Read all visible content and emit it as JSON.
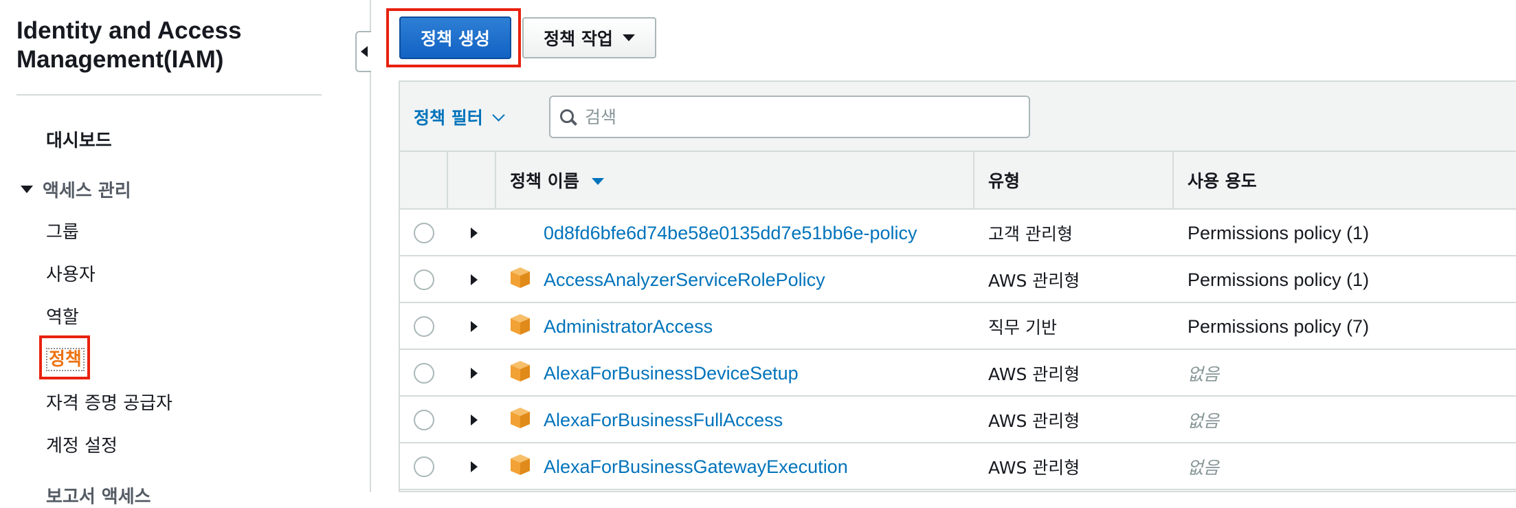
{
  "sidebar": {
    "title": "Identity and Access Management(IAM)",
    "dashboard": "대시보드",
    "section_access": "액세스 관리",
    "items": [
      "그룹",
      "사용자",
      "역할",
      "정책",
      "자격 증명 공급자",
      "계정 설정"
    ],
    "next_section": "보고서 액세스"
  },
  "toolbar": {
    "create_label": "정책 생성",
    "actions_label": "정책 작업"
  },
  "filter": {
    "label": "정책 필터",
    "search_placeholder": "검색"
  },
  "table": {
    "columns": [
      "정책 이름",
      "유형",
      "사용 용도"
    ],
    "rows": [
      {
        "name": "0d8fd6bfe6d74be58e0135dd7e51bb6e-policy",
        "type": "고객 관리형",
        "usage": "Permissions policy (1)",
        "aws_icon": false
      },
      {
        "name": "AccessAnalyzerServiceRolePolicy",
        "type": "AWS 관리형",
        "usage": "Permissions policy (1)",
        "aws_icon": true
      },
      {
        "name": "AdministratorAccess",
        "type": "직무 기반",
        "usage": "Permissions policy (7)",
        "aws_icon": true
      },
      {
        "name": "AlexaForBusinessDeviceSetup",
        "type": "AWS 관리형",
        "usage": "없음",
        "aws_icon": true
      },
      {
        "name": "AlexaForBusinessFullAccess",
        "type": "AWS 관리형",
        "usage": "없음",
        "aws_icon": true
      },
      {
        "name": "AlexaForBusinessGatewayExecution",
        "type": "AWS 관리형",
        "usage": "없음",
        "aws_icon": true
      }
    ]
  },
  "colors": {
    "link": "#0073bb",
    "primary_button": "#1a6fcf",
    "active_nav": "#ec7211",
    "highlight": "#e8210f",
    "aws_icon": "#f2a134"
  }
}
